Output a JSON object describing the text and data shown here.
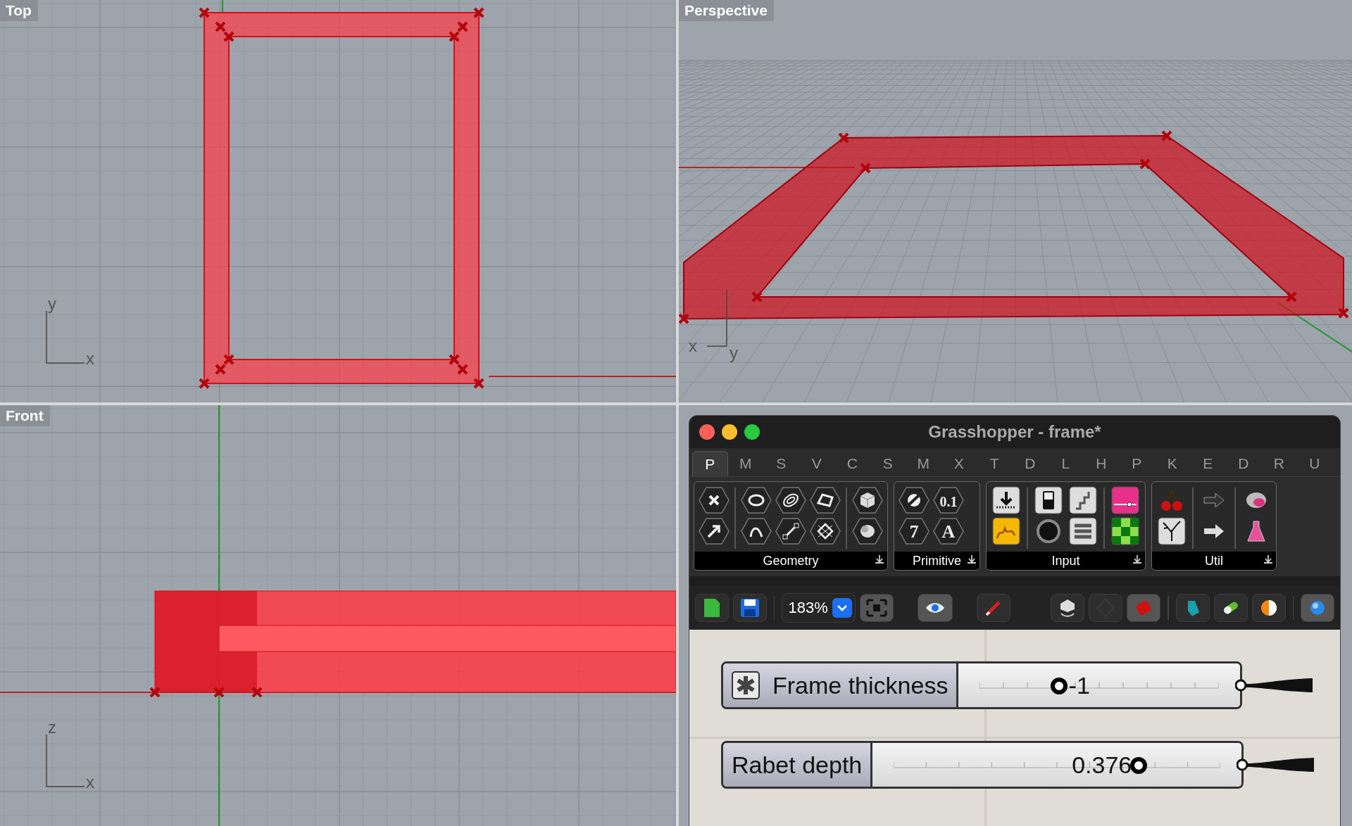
{
  "viewports": [
    {
      "title": "Top",
      "axes": [
        "y",
        "x"
      ]
    },
    {
      "title": "Perspective",
      "axes": [
        "x",
        "y"
      ]
    },
    {
      "title": "Front",
      "axes": [
        "z",
        "x"
      ]
    }
  ],
  "grasshopper": {
    "title": "Grasshopper - frame*",
    "tabs": [
      {
        "label": "P",
        "selected": true
      },
      {
        "label": "M",
        "selected": false
      },
      {
        "label": "S",
        "selected": false
      },
      {
        "label": "V",
        "selected": false
      },
      {
        "label": "C",
        "selected": false
      },
      {
        "label": "S",
        "selected": false
      },
      {
        "label": "M",
        "selected": false
      },
      {
        "label": "X",
        "selected": false
      },
      {
        "label": "T",
        "selected": false
      },
      {
        "label": "D",
        "selected": false
      },
      {
        "label": "L",
        "selected": false
      },
      {
        "label": "H",
        "selected": false
      },
      {
        "label": "P",
        "selected": false
      },
      {
        "label": "K",
        "selected": false
      },
      {
        "label": "E",
        "selected": false
      },
      {
        "label": "D",
        "selected": false
      },
      {
        "label": "R",
        "selected": false
      },
      {
        "label": "U",
        "selected": false
      }
    ],
    "groups": [
      {
        "label": "Geometry"
      },
      {
        "label": "Primitive",
        "glyphs": [
          "0.1",
          "7",
          "A"
        ]
      },
      {
        "label": "Input"
      },
      {
        "label": "Util"
      }
    ],
    "zoom": "183%",
    "sliders": [
      {
        "label": "Frame thickness",
        "value": "-1",
        "level": 0.33,
        "kind": "expression"
      },
      {
        "label": "Rabet depth",
        "value": "0.376",
        "level": 0.75,
        "kind": "plain"
      }
    ]
  }
}
